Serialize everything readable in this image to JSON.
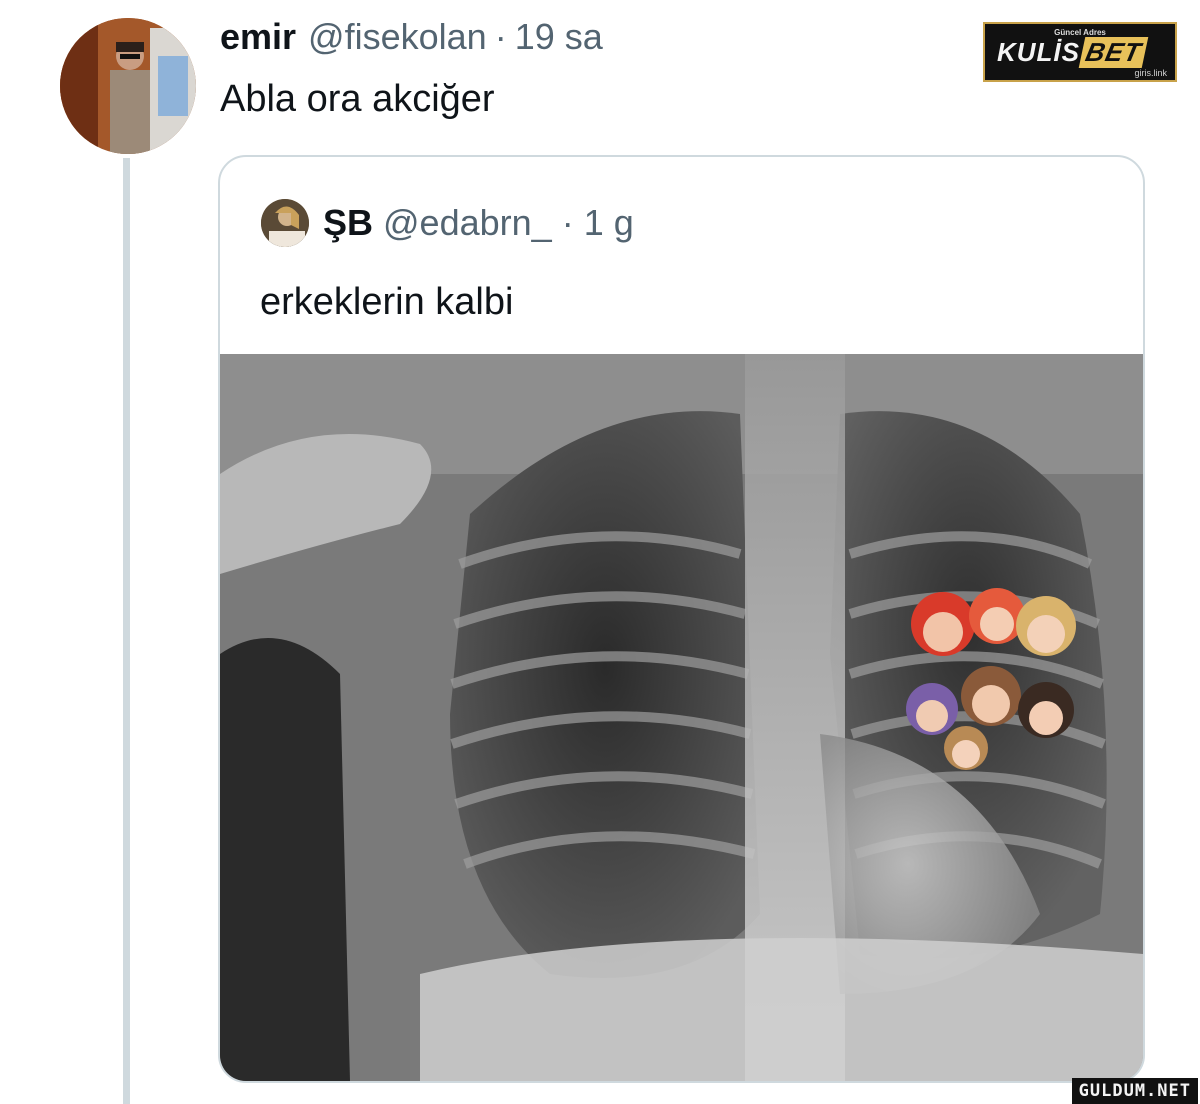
{
  "tweet": {
    "display_name": "emir",
    "handle": "@fisekolan",
    "separator": "·",
    "time": "19 sa",
    "text": "Abla ora akciğer"
  },
  "quoted_tweet": {
    "display_name": "ŞB",
    "handle": "@edabrn_",
    "separator": "·",
    "time": "1 g",
    "text": "erkeklerin kalbi"
  },
  "brand_badge": {
    "top_text": "Güncel Adres",
    "name_main": "KULİS",
    "name_accent": "BET",
    "sub_text": "giris.link"
  },
  "watermark": "GULDUM.NET",
  "colors": {
    "text_primary": "#0f1419",
    "text_secondary": "#536471",
    "border": "#cfd9de",
    "brand_gold": "#e8c15a"
  }
}
